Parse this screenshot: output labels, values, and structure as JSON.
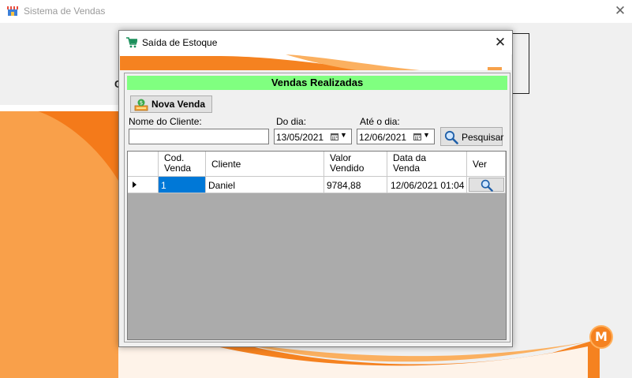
{
  "main_window": {
    "title": "Sistema de Vendas",
    "close_glyph": "✕",
    "partial_label": "C",
    "logo_letter": "M",
    "accent_color": "#f58220"
  },
  "dialog": {
    "title": "Saída de Estoque",
    "close_glyph": "✕",
    "header": "Vendas Realizadas",
    "new_sale_button": "Nova Venda",
    "filters": {
      "client_label": "Nome do Cliente:",
      "client_value": "",
      "from_label": "Do dia:",
      "from_value": "13/05/2021",
      "to_label": "Até o dia:",
      "to_value": "12/06/2021",
      "search_button": "Pesquisar"
    },
    "grid": {
      "columns": [
        "Cod.\nVenda",
        "Cliente",
        "Valor\nVendido",
        "Data da\nVenda",
        "Ver"
      ],
      "rows": [
        {
          "cod": "1",
          "cliente": "Daniel",
          "valor": "9784,88",
          "data": "12/06/2021 01:04",
          "ver_icon": "magnifier-icon"
        }
      ]
    }
  }
}
